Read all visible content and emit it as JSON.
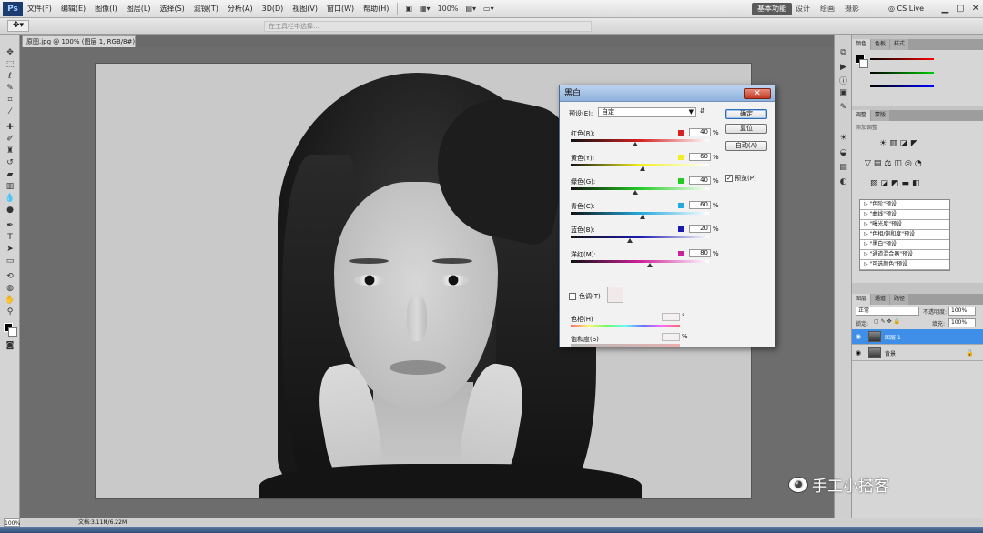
{
  "app": {
    "logo": "Ps"
  },
  "menu": [
    "文件(F)",
    "编辑(E)",
    "图像(I)",
    "图层(L)",
    "选择(S)",
    "滤镜(T)",
    "分析(A)",
    "3D(D)",
    "视图(V)",
    "窗口(W)",
    "帮助(H)"
  ],
  "menubar_controls": {
    "zoom": "100%"
  },
  "workspace": {
    "active": "基本功能",
    "others": [
      "设计",
      "绘画",
      "摄影"
    ],
    "cs_live": "CS Live"
  },
  "options_bar": {
    "hint": "在工具栏中选择..."
  },
  "document": {
    "tab_title": "原图.jpg @ 100% (图层 1, RGB/8#) *"
  },
  "dialog": {
    "title": "黑白",
    "close": "✕",
    "preset_label": "预设(E):",
    "preset_value": "自定",
    "buttons": {
      "ok": "确定",
      "reset": "复位",
      "auto": "自动(A)"
    },
    "preview_label": "预览(P)",
    "channels": [
      {
        "label": "红色(R):",
        "value": "40",
        "unit": "%",
        "color": "#d42222",
        "fraction": 0.47
      },
      {
        "label": "黄色(Y):",
        "value": "60",
        "unit": "%",
        "color": "#f0f020",
        "fraction": 0.52
      },
      {
        "label": "绿色(G):",
        "value": "40",
        "unit": "%",
        "color": "#22cc22",
        "fraction": 0.47
      },
      {
        "label": "青色(C):",
        "value": "60",
        "unit": "%",
        "color": "#22aadd",
        "fraction": 0.52
      },
      {
        "label": "蓝色(B):",
        "value": "20",
        "unit": "%",
        "color": "#1a1ab0",
        "fraction": 0.43
      },
      {
        "label": "洋红(M):",
        "value": "80",
        "unit": "%",
        "color": "#cc2299",
        "fraction": 0.57
      }
    ],
    "tint_label": "色调(T)",
    "hue_label": "色相(H)",
    "hue_unit": "°",
    "saturation_label": "饱和度(S)",
    "saturation_unit": "%"
  },
  "panels": {
    "color_tabs": [
      "颜色",
      "色板",
      "样式"
    ],
    "adjust_tabs": [
      "调整",
      "蒙版"
    ],
    "adjust_hint": "添加调整",
    "presets": [
      "\"色阶\"预设",
      "\"曲线\"预设",
      "\"曝光度\"预设",
      "\"色相/饱和度\"预设",
      "\"黑白\"预设",
      "\"通道混合器\"预设",
      "\"可选颜色\"预设"
    ],
    "layers_tabs": [
      "图层",
      "通道",
      "路径"
    ],
    "blend_mode": "正常",
    "opacity_label": "不透明度:",
    "opacity": "100%",
    "lock_label": "锁定:",
    "fill_label": "填充:",
    "fill": "100%",
    "layers": [
      {
        "name": "图层 1",
        "selected": true
      },
      {
        "name": "背景",
        "selected": false
      }
    ]
  },
  "status": {
    "zoom": "100%",
    "doc": "文档:3.11M/6.22M"
  },
  "watermark": {
    "text": "手工小搭客"
  }
}
